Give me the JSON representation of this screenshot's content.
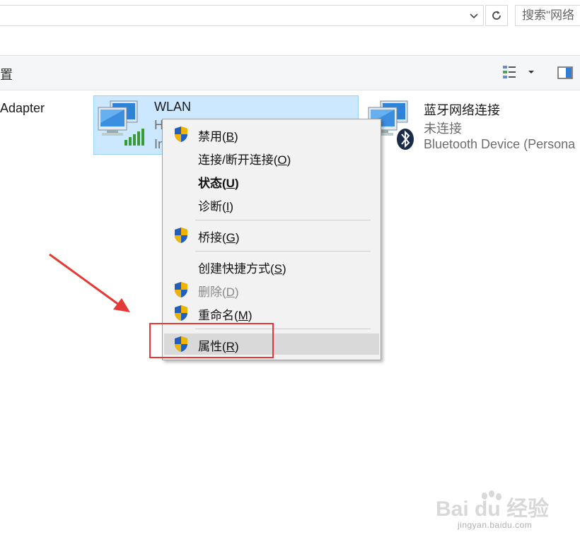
{
  "toolbar": {
    "search_placeholder": "搜索\"网络",
    "left_cut_text": "置"
  },
  "items": {
    "adapter_cut_label": "Adapter",
    "wlan": {
      "name": "WLAN",
      "sub1_cut": "H",
      "sub2_cut": "In"
    },
    "bluetooth": {
      "name": "蓝牙网络连接",
      "status": "未连接",
      "device": "Bluetooth Device (Persona"
    }
  },
  "context_menu": {
    "items": [
      {
        "text": "禁用(",
        "key": "B",
        "tail": ")",
        "shield": true
      },
      {
        "text": "连接/断开连接(",
        "key": "O",
        "tail": ")",
        "shield": false
      },
      {
        "text": "状态(",
        "key": "U",
        "tail": ")",
        "shield": false,
        "bold": true
      },
      {
        "text": "诊断(",
        "key": "I",
        "tail": ")",
        "shield": false
      },
      {
        "text": "桥接(",
        "key": "G",
        "tail": ")",
        "shield": true
      },
      {
        "text": "创建快捷方式(",
        "key": "S",
        "tail": ")",
        "shield": false
      },
      {
        "text": "删除(",
        "key": "D",
        "tail": ")",
        "shield": true,
        "disabled": true
      },
      {
        "text": "重命名(",
        "key": "M",
        "tail": ")",
        "shield": true
      },
      {
        "text": "属性(",
        "key": "R",
        "tail": ")",
        "shield": true,
        "highlighted": true
      }
    ]
  },
  "watermark": {
    "brand": "Bai du 经验",
    "url": "jingyan.baidu.com"
  },
  "colors": {
    "selection": "#cce8ff",
    "annotation": "#e53935",
    "menu_bg": "#f2f2f2"
  }
}
